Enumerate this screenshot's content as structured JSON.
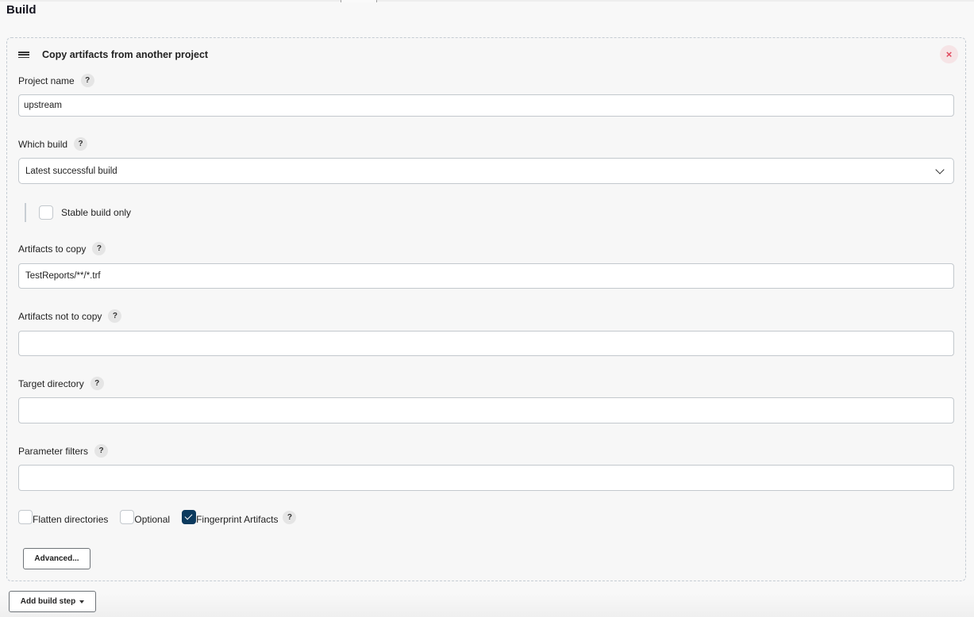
{
  "section": {
    "title": "Build"
  },
  "step": {
    "title": "Copy artifacts from another project",
    "icons": {
      "drag": "drag-handle-icon",
      "close": "close-icon"
    },
    "close_glyph": "×",
    "help_glyph": "?",
    "fields": {
      "project_name": {
        "label": "Project name",
        "value": "upstream",
        "placeholder": ""
      },
      "which_build": {
        "label": "Which build",
        "selected": "Latest successful build"
      },
      "stable_only": {
        "label": "Stable build only",
        "checked": false
      },
      "artifacts_to_copy": {
        "label": "Artifacts to copy",
        "value": "TestReports/**/*.trf"
      },
      "artifacts_not_to_copy": {
        "label": "Artifacts not to copy",
        "value": ""
      },
      "target_directory": {
        "label": "Target directory",
        "value": ""
      },
      "parameter_filters": {
        "label": "Parameter filters",
        "value": ""
      }
    },
    "options": [
      {
        "label": "Flatten directories",
        "checked": false
      },
      {
        "label": "Optional",
        "checked": false
      },
      {
        "label": "Fingerprint Artifacts",
        "checked": true
      }
    ],
    "advanced_label": "Advanced..."
  },
  "add_build_step_label": "Add build step",
  "colors": {
    "accent": "#0b3a5e",
    "danger": "#e0475b",
    "danger_bg": "#f6e4e6"
  }
}
